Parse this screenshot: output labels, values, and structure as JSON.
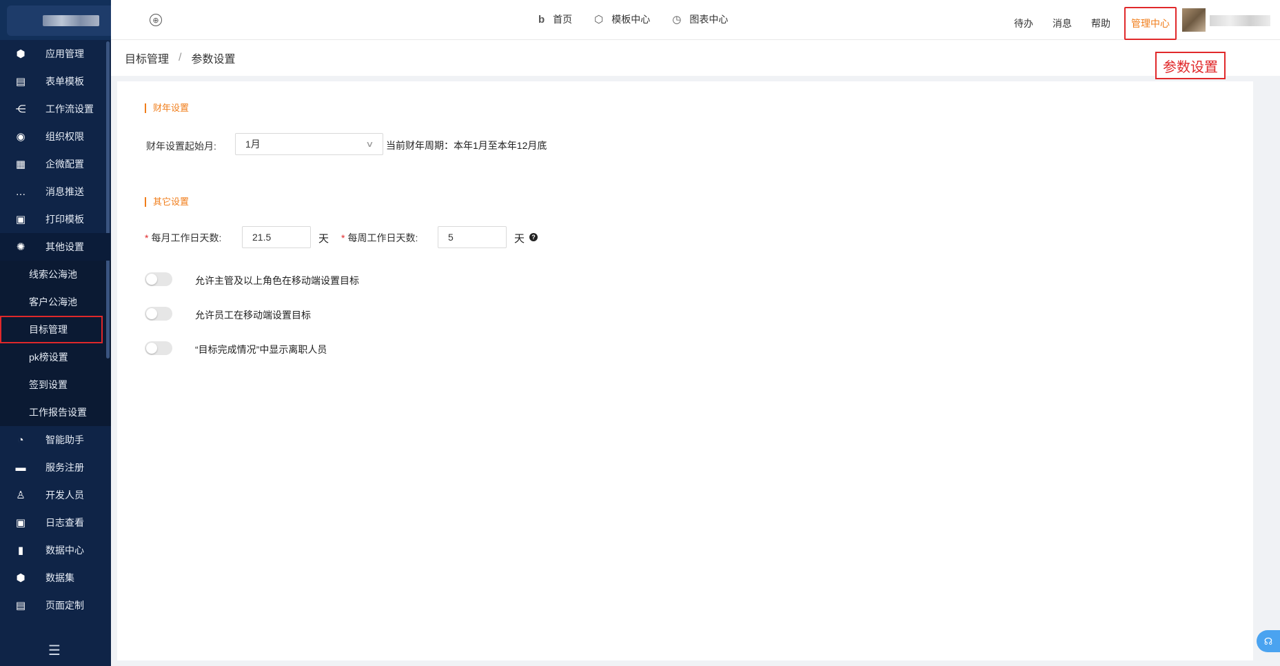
{
  "sidebar": {
    "items": [
      {
        "label": "应用管理",
        "icon": "cube-icon",
        "glyph": "⬢"
      },
      {
        "label": "表单模板",
        "icon": "form-icon",
        "glyph": "▤"
      },
      {
        "label": "工作流设置",
        "icon": "workflow-icon",
        "glyph": "⋲"
      },
      {
        "label": "组织权限",
        "icon": "user-circle-icon",
        "glyph": "◉"
      },
      {
        "label": "企微配置",
        "icon": "chat-cards-icon",
        "glyph": "▦"
      },
      {
        "label": "消息推送",
        "icon": "message-icon",
        "glyph": "…"
      },
      {
        "label": "打印模板",
        "icon": "printer-icon",
        "glyph": "▣"
      },
      {
        "label": "其他设置",
        "icon": "gear-icon",
        "glyph": "✺"
      }
    ],
    "subitems": [
      {
        "label": "线索公海池"
      },
      {
        "label": "客户公海池"
      },
      {
        "label": "目标管理"
      },
      {
        "label": "pk榜设置"
      },
      {
        "label": "签到设置"
      },
      {
        "label": "工作报告设置"
      }
    ],
    "items_bottom": [
      {
        "label": "智能助手",
        "icon": "pie-icon",
        "glyph": "◔"
      },
      {
        "label": "服务注册",
        "icon": "document-icon",
        "glyph": "▬"
      },
      {
        "label": "开发人员",
        "icon": "developer-icon",
        "glyph": "♙"
      },
      {
        "label": "日志查看",
        "icon": "lock-icon",
        "glyph": "🔒"
      },
      {
        "label": "数据中心",
        "icon": "bar-chart-icon",
        "glyph": "▮"
      },
      {
        "label": "数据集",
        "icon": "dataset-icon",
        "glyph": "⬢"
      },
      {
        "label": "页面定制",
        "icon": "page-icon",
        "glyph": "▤"
      }
    ],
    "collapse_glyph": "☰"
  },
  "topbar": {
    "nav": [
      {
        "label": "首页",
        "glyph": "b"
      },
      {
        "label": "模板中心",
        "glyph": "⬡"
      },
      {
        "label": "图表中心",
        "glyph": "◷"
      }
    ],
    "right": {
      "todo": "待办",
      "messages": "消息",
      "help": "帮助",
      "admin": "管理中心"
    }
  },
  "annotation": "参数设置",
  "breadcrumb": {
    "parent": "目标管理",
    "sep": "/",
    "current": "参数设置"
  },
  "fiscal": {
    "section_title": "财年设置",
    "start_month_label": "财年设置起始月:",
    "start_month_value": "1月",
    "period_text": "当前财年周期：本年1月至本年12月底"
  },
  "other": {
    "section_title": "其它设置",
    "monthly_label": "每月工作日天数:",
    "monthly_value": "21.5",
    "monthly_unit": "天",
    "weekly_label": "每周工作日天数:",
    "weekly_value": "5",
    "weekly_unit": "天",
    "required_mark": "*",
    "toggles": [
      {
        "label": "允许主管及以上角色在移动端设置目标",
        "on": false
      },
      {
        "label": "允许员工在移动端设置目标",
        "on": false
      },
      {
        "label": "“目标完成情况”中显示离职人员",
        "on": false
      }
    ]
  },
  "colors": {
    "accent": "#f07d1a",
    "highlight": "#e0282a",
    "sidebar": "#0f2447"
  }
}
